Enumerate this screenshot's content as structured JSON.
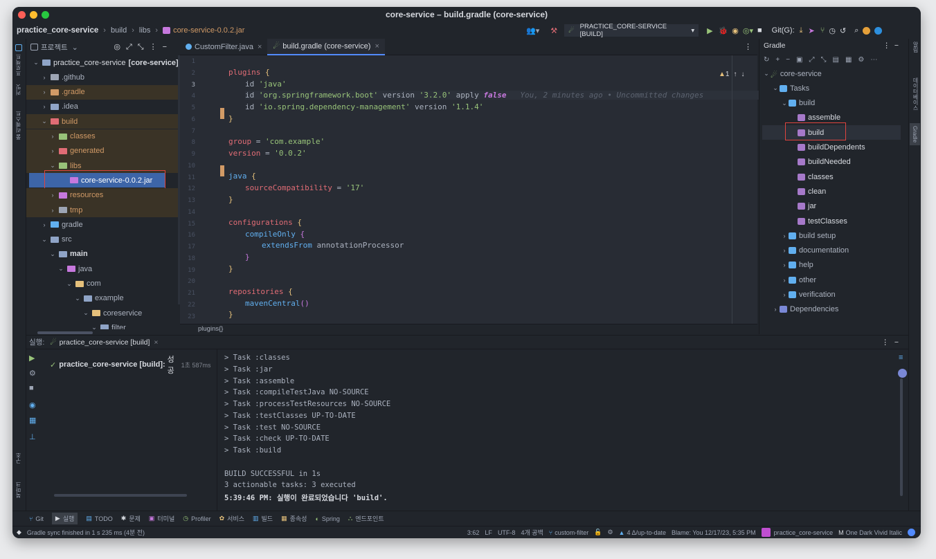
{
  "window": {
    "title": "core-service – build.gradle (core-service)"
  },
  "navbar": {
    "project": "practice_core-service",
    "crumbs": [
      "build",
      "libs"
    ],
    "file": "core-service-0.0.2.jar",
    "run_config": "PRACTICE_CORE-SERVICE [BUILD]",
    "git_label": "Git(G):"
  },
  "left_stripe": {
    "project": "프로젝트",
    "commit": "커밋",
    "pull": "풀 리퀘스트",
    "structure": "구조",
    "bookmarks": "북마크"
  },
  "project_panel": {
    "title": "프로젝트",
    "items": [
      {
        "label": "practice_core-service",
        "bold_suffix": "[core-service]",
        "indent": 0,
        "arrow": "v",
        "color": "#8fa4c7",
        "text": "#d7dae0",
        "y": 0
      },
      {
        "label": ".github",
        "indent": 1,
        "arrow": ">",
        "color": "#9da5b4",
        "text": "#abb2bf",
        "y": 1
      },
      {
        "label": ".gradle",
        "indent": 1,
        "arrow": ">",
        "color": "#d19a66",
        "text": "#d19a66",
        "y": 2,
        "bg": "#3a3326"
      },
      {
        "label": ".idea",
        "indent": 1,
        "arrow": ">",
        "color": "#8fa4c7",
        "text": "#abb2bf",
        "y": 3
      },
      {
        "label": "build",
        "indent": 1,
        "arrow": "v",
        "color": "#e06c75",
        "text": "#d19a66",
        "y": 4,
        "bg": "#3a3326"
      },
      {
        "label": "classes",
        "indent": 2,
        "arrow": ">",
        "color": "#98c379",
        "text": "#d19a66",
        "y": 5,
        "bg": "#3a3326"
      },
      {
        "label": "generated",
        "indent": 2,
        "arrow": ">",
        "color": "#e06c75",
        "text": "#d19a66",
        "y": 6,
        "bg": "#3a3326"
      },
      {
        "label": "libs",
        "indent": 2,
        "arrow": "v",
        "color": "#98c379",
        "text": "#d19a66",
        "y": 7,
        "bg": "#3a3326"
      },
      {
        "label": "core-service-0.0.2.jar",
        "indent": 3,
        "arrow": "",
        "color": "#c678dd",
        "text": "#ffffff",
        "y": 8,
        "selected": true
      },
      {
        "label": "resources",
        "indent": 2,
        "arrow": ">",
        "color": "#c678dd",
        "text": "#d19a66",
        "y": 9,
        "bg": "#3a3326"
      },
      {
        "label": "tmp",
        "indent": 2,
        "arrow": ">",
        "color": "#9da5b4",
        "text": "#d19a66",
        "y": 10,
        "bg": "#3a3326"
      },
      {
        "label": "gradle",
        "indent": 1,
        "arrow": ">",
        "color": "#61afef",
        "text": "#abb2bf",
        "y": 11
      },
      {
        "label": "src",
        "indent": 1,
        "arrow": "v",
        "color": "#8fa4c7",
        "text": "#abb2bf",
        "y": 12
      },
      {
        "label": "main",
        "indent": 2,
        "arrow": "v",
        "color": "#8fa4c7",
        "text": "#d7dae0",
        "y": 13,
        "bold": true
      },
      {
        "label": "java",
        "indent": 3,
        "arrow": "v",
        "color": "#c678dd",
        "text": "#abb2bf",
        "y": 14
      },
      {
        "label": "com",
        "indent": 4,
        "arrow": "v",
        "color": "#e5c07b",
        "text": "#abb2bf",
        "y": 15
      },
      {
        "label": "example",
        "indent": 5,
        "arrow": "v",
        "color": "#8fa4c7",
        "text": "#abb2bf",
        "y": 16
      },
      {
        "label": "coreservice",
        "indent": 6,
        "arrow": "v",
        "color": "#e5c07b",
        "text": "#abb2bf",
        "y": 17
      },
      {
        "label": "filter",
        "indent": 7,
        "arrow": "v",
        "color": "#8fa4c7",
        "text": "#abb2bf",
        "y": 18
      }
    ]
  },
  "editor": {
    "tabs": [
      {
        "label": "CustomFilter.java",
        "active": false
      },
      {
        "label": "build.gradle (core-service)",
        "active": true
      }
    ],
    "inspection": "1",
    "breadcrumb": "plugins{}",
    "blame": "You, 2 minutes ago • Uncommitted changes",
    "line_numbers": [
      "1",
      "2",
      "3",
      "4",
      "5",
      "6",
      "7",
      "8",
      "9",
      "10",
      "11",
      "12",
      "13",
      "14",
      "15",
      "16",
      "17",
      "18",
      "19",
      "20",
      "21",
      "22",
      "23"
    ]
  },
  "gradle_panel": {
    "title": "Gradle",
    "items": [
      {
        "label": "core-service",
        "level": 0,
        "arrow": "v",
        "y": 0
      },
      {
        "label": "Tasks",
        "level": 1,
        "arrow": "v",
        "y": 1
      },
      {
        "label": "build",
        "level": 2,
        "arrow": "v",
        "y": 2
      },
      {
        "label": "assemble",
        "level": 3,
        "arrow": "",
        "y": 3
      },
      {
        "label": "build",
        "level": 3,
        "arrow": "",
        "y": 4,
        "selected": true
      },
      {
        "label": "buildDependents",
        "level": 3,
        "arrow": "",
        "y": 5
      },
      {
        "label": "buildNeeded",
        "level": 3,
        "arrow": "",
        "y": 6
      },
      {
        "label": "classes",
        "level": 3,
        "arrow": "",
        "y": 7
      },
      {
        "label": "clean",
        "level": 3,
        "arrow": "",
        "y": 8
      },
      {
        "label": "jar",
        "level": 3,
        "arrow": "",
        "y": 9
      },
      {
        "label": "testClasses",
        "level": 3,
        "arrow": "",
        "y": 10
      },
      {
        "label": "build setup",
        "level": 2,
        "arrow": ">",
        "y": 11
      },
      {
        "label": "documentation",
        "level": 2,
        "arrow": ">",
        "y": 12
      },
      {
        "label": "help",
        "level": 2,
        "arrow": ">",
        "y": 13
      },
      {
        "label": "other",
        "level": 2,
        "arrow": ">",
        "y": 14
      },
      {
        "label": "verification",
        "level": 2,
        "arrow": ">",
        "y": 15
      },
      {
        "label": "Dependencies",
        "level": 1,
        "arrow": ">",
        "y": 16
      }
    ]
  },
  "right_stripe": {
    "db": "데이터베이스",
    "gradle": "Gradle",
    "notif": "알림"
  },
  "run_panel": {
    "label": "실행:",
    "tab": "practice_core-service [build]",
    "node": "practice_core-service [build]:",
    "node_suffix": "성공",
    "time": "1초 587ms",
    "output": [
      "> Task :classes",
      "> Task :jar",
      "> Task :assemble",
      "> Task :compileTestJava NO-SOURCE",
      "> Task :processTestResources NO-SOURCE",
      "> Task :testClasses UP-TO-DATE",
      "> Task :test NO-SOURCE",
      "> Task :check UP-TO-DATE",
      "> Task :build",
      "",
      "BUILD SUCCESSFUL in 1s",
      "3 actionable tasks: 3 executed",
      "5:39:46 PM: 실행이 완료되었습니다 'build'."
    ]
  },
  "tool_windows": [
    "Git",
    "실행",
    "TODO",
    "문제",
    "터미널",
    "Profiler",
    "서비스",
    "빌드",
    "종속성",
    "Spring",
    "엔드포인트"
  ],
  "status": {
    "message": "Gradle sync finished in 1 s 235 ms (4분 전)",
    "pos": "3:62",
    "lf": "LF",
    "enc": "UTF-8",
    "indent": "4개 공백",
    "branch": "custom-filter",
    "vcs": "4 Δ/up-to-date",
    "blame": "Blame: You 12/17/23, 5:35 PM",
    "project": "practice_core-service",
    "theme": "One Dark Vivid Italic"
  },
  "colors": {
    "accent": "#3d65a8",
    "highlight": "#e0443e",
    "success": "#98c379"
  }
}
